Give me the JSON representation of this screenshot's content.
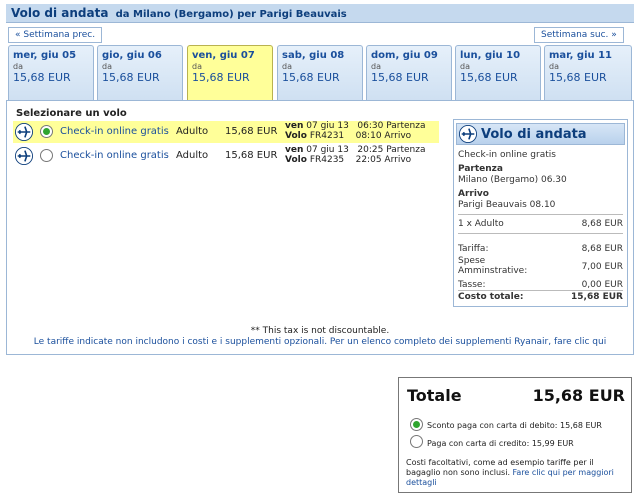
{
  "header": {
    "title": "Volo di andata",
    "route": "da Milano (Bergamo) per Parigi Beauvais"
  },
  "nav": {
    "prev_week": "« Settimana prec.",
    "next_week": "Settimana suc. »"
  },
  "dates": [
    {
      "day": "mer, giu 05",
      "from": "da",
      "price": "15,68 EUR"
    },
    {
      "day": "gio, giu 06",
      "from": "da",
      "price": "15,68 EUR"
    },
    {
      "day": "ven, giu 07",
      "from": "da",
      "price": "15,68 EUR"
    },
    {
      "day": "sab, giu 08",
      "from": "da",
      "price": "15,68 EUR"
    },
    {
      "day": "dom, giu 09",
      "from": "da",
      "price": "15,68 EUR"
    },
    {
      "day": "lun, giu 10",
      "from": "da",
      "price": "15,68 EUR"
    },
    {
      "day": "mar, giu 11",
      "from": "da",
      "price": "15,68 EUR"
    }
  ],
  "select_title": "Selezionare un volo",
  "flights": [
    {
      "checkin": "Check-in online gratis",
      "passenger": "Adulto",
      "price": "15,68 EUR",
      "weekday": "ven",
      "date": "07 giu 13",
      "dep_time": "06:30",
      "dep_label": "Partenza",
      "flight_label": "Volo",
      "flight_no": "FR4231",
      "arr_time": "08:10",
      "arr_label": "Arrivo"
    },
    {
      "checkin": "Check-in online gratis",
      "passenger": "Adulto",
      "price": "15,68 EUR",
      "weekday": "ven",
      "date": "07 giu 13",
      "dep_time": "20:25",
      "dep_label": "Partenza",
      "flight_label": "Volo",
      "flight_no": "FR4235",
      "arr_time": "22:05",
      "arr_label": "Arrivo"
    }
  ],
  "summary": {
    "title": "Volo di andata",
    "checkin": "Check-in online gratis",
    "dep_label": "Partenza",
    "dep_detail": "Milano (Bergamo) 06.30",
    "arr_label": "Arrivo",
    "arr_detail": "Parigi Beauvais 08.10",
    "pax_label": "1 x Adulto",
    "pax_value": "8,68 EUR",
    "fare_label": "Tariffa:",
    "fare_value": "8,68 EUR",
    "fees_label_1": "Spese",
    "fees_label_2": "Amminstrative:",
    "fees_value": "7,00 EUR",
    "tax_label": "Tasse:",
    "tax_value": "0,00 EUR",
    "total_label": "Costo totale:",
    "total_value": "15,68 EUR"
  },
  "notes": {
    "tax": "** This tax is not discountable.",
    "fees": "Le tariffe indicate non includono i costi e i supplementi opzionali. Per un elenco completo dei supplementi Ryanair, fare clic qui"
  },
  "totals": {
    "label": "Totale",
    "value": "15,68 EUR",
    "debit": "Sconto paga con carta di debito: 15,68 EUR",
    "credit": "Paga con carta di credito: 15,99 EUR",
    "optional_text": "Costi facoltativi, come ad esempio tariffe per il bagaglio non sono inclusi.",
    "optional_link": "Fare clic qui per maggiori dettagli"
  },
  "colors": {
    "accent": "#1a4f9c",
    "selected": "#ffff99",
    "header_bg": "#c5d9ee"
  }
}
